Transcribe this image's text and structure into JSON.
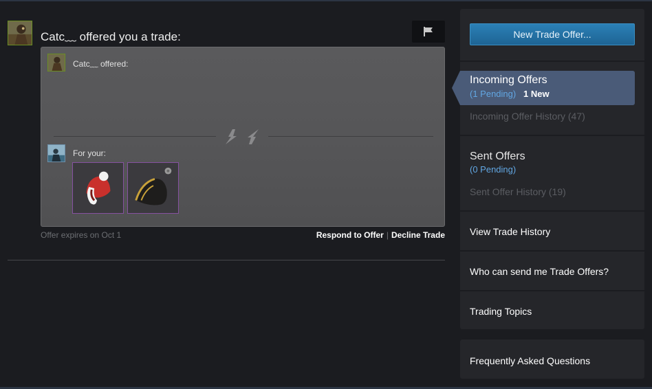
{
  "offer": {
    "header": "Catc﹏ offered you a trade:",
    "partner_offered_label": "Catc﹏ offered:",
    "for_your_label": "For your:",
    "items": [
      {
        "name": "red-beanie-icon"
      },
      {
        "name": "bicorne-hat-icon"
      }
    ],
    "expires": "Offer expires on Oct 1",
    "respond_label": "Respond to Offer",
    "separator": "|",
    "decline_label": "Decline Trade"
  },
  "sidebar": {
    "new_offer_button": "New Trade Offer...",
    "incoming": {
      "title": "Incoming Offers",
      "pending": "(1 Pending)",
      "new": "1 New",
      "history": "Incoming Offer History (47)"
    },
    "sent": {
      "title": "Sent Offers",
      "pending": "(0 Pending)",
      "history": "Sent Offer History (19)"
    },
    "links": {
      "view_trade_history": "View Trade History",
      "who_can_send": "Who can send me Trade Offers?",
      "trading_topics": "Trading Topics",
      "faq": "Frequently Asked Questions"
    }
  },
  "colors": {
    "accent_blue": "#62a7e3",
    "button_blue": "#2b80b6",
    "active_tab": "#4a5b78",
    "item_border_unusual": "#8651a1"
  }
}
